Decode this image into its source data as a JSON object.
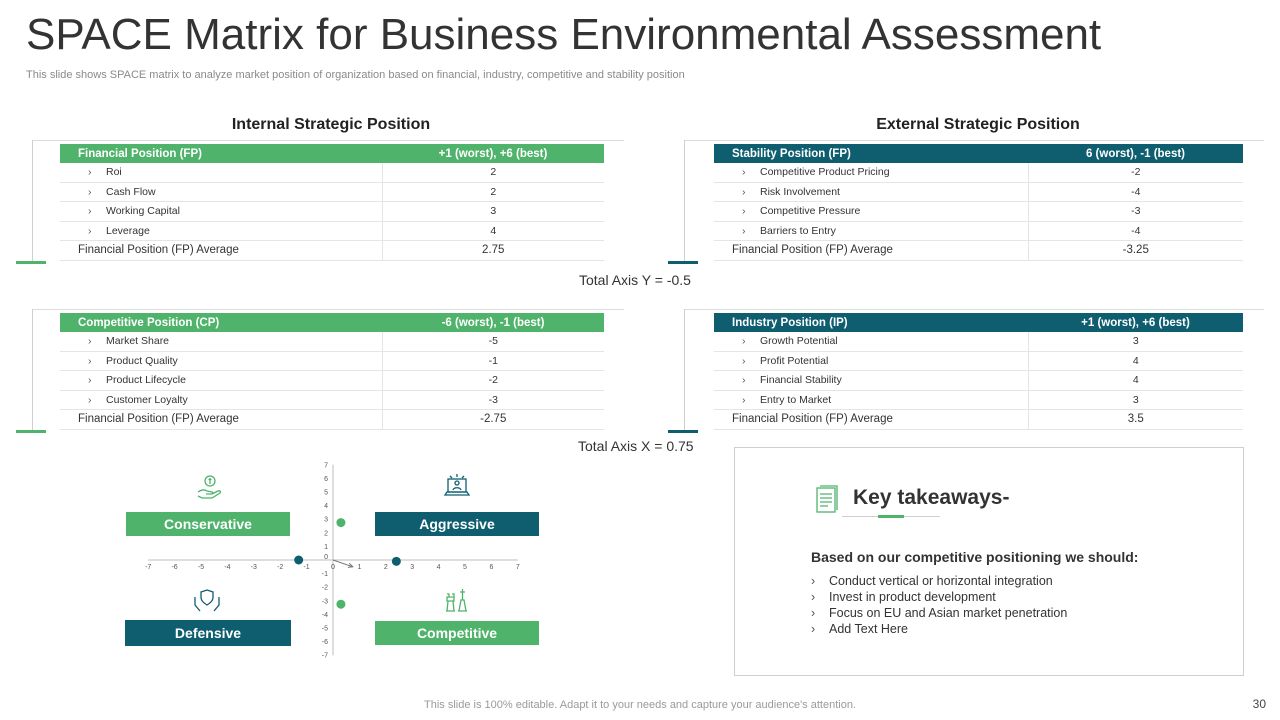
{
  "title": "SPACE Matrix for Business Environmental Assessment",
  "subtitle": "This slide shows SPACE matrix to analyze market position of organization based on financial, industry, competitive and stability position",
  "colors": {
    "green": "#4fb36b",
    "teal": "#0e5e6f"
  },
  "internal": {
    "heading": "Internal Strategic Position",
    "fp": {
      "header": [
        "Financial Position (FP)",
        "+1 (worst), +6 (best)"
      ],
      "rows": [
        [
          "Roi",
          "2"
        ],
        [
          "Cash Flow",
          "2"
        ],
        [
          "Working Capital",
          "3"
        ],
        [
          "Leverage",
          "4"
        ]
      ],
      "avg": [
        "Financial Position (FP) Average",
        "2.75"
      ]
    },
    "cp": {
      "header": [
        "Competitive Position (CP)",
        "-6 (worst), -1 (best)"
      ],
      "rows": [
        [
          "Market Share",
          "-5"
        ],
        [
          "Product Quality",
          "-1"
        ],
        [
          "Product Lifecycle",
          "-2"
        ],
        [
          "Customer Loyalty",
          "-3"
        ]
      ],
      "avg": [
        "Financial Position (FP) Average",
        "-2.75"
      ]
    }
  },
  "external": {
    "heading": "External Strategic Position",
    "sp": {
      "header": [
        "Stability Position (FP)",
        "6 (worst), -1 (best)"
      ],
      "rows": [
        [
          "Competitive Product Pricing",
          "-2"
        ],
        [
          "Risk Involvement",
          "-4"
        ],
        [
          "Competitive Pressure",
          "-3"
        ],
        [
          "Barriers to Entry",
          "-4"
        ]
      ],
      "avg": [
        "Financial Position (FP) Average",
        "-3.25"
      ]
    },
    "ip": {
      "header": [
        "Industry Position (IP)",
        "+1 (worst), +6 (best)"
      ],
      "rows": [
        [
          "Growth Potential",
          "3"
        ],
        [
          "Profit Potential",
          "4"
        ],
        [
          "Financial Stability",
          "4"
        ],
        [
          "Entry to Market",
          "3"
        ]
      ],
      "avg": [
        "Financial Position (FP) Average",
        "3.5"
      ]
    }
  },
  "totals": {
    "y": "Total Axis Y = -0.5",
    "x": "Total Axis X = 0.75"
  },
  "quadrants": {
    "conservative": "Conservative",
    "aggressive": "Aggressive",
    "defensive": "Defensive",
    "competitive": "Competitive"
  },
  "chart_data": {
    "type": "scatter",
    "title": "",
    "xlabel": "",
    "ylabel": "",
    "xlim": [
      -7,
      7
    ],
    "ylim": [
      -7,
      7
    ],
    "x_ticks": [
      "-7",
      "-6",
      "-5",
      "-4",
      "-3",
      "-2",
      "-1",
      "0",
      "1",
      "2",
      "3",
      "4",
      "5",
      "6",
      "7"
    ],
    "y_ticks": [
      "7",
      "6",
      "5",
      "4",
      "3",
      "2",
      "1",
      "0",
      "-1",
      "-2",
      "-3",
      "-4",
      "-5",
      "-6",
      "-7"
    ],
    "points": [
      {
        "x": 0.3,
        "y": 2.75,
        "color": "#4fb36b"
      },
      {
        "x": 2.4,
        "y": -0.1,
        "color": "#0e5e6f"
      },
      {
        "x": -1.3,
        "y": 0.0,
        "color": "#0e5e6f"
      },
      {
        "x": 0.3,
        "y": -3.25,
        "color": "#4fb36b"
      }
    ],
    "vector": {
      "from": [
        0,
        0
      ],
      "to": [
        0.75,
        -0.5
      ]
    }
  },
  "takeaways": {
    "title": "Key takeaways-",
    "lead": "Based on our competitive positioning we should:",
    "items": [
      "Conduct vertical  or horizontal integration",
      "Invest  in product  development",
      "Focus on EU and Asian market penetration",
      "Add Text Here"
    ]
  },
  "footer": "This slide is 100% editable. Adapt it to your needs and capture your audience's attention.",
  "page_number": "30"
}
